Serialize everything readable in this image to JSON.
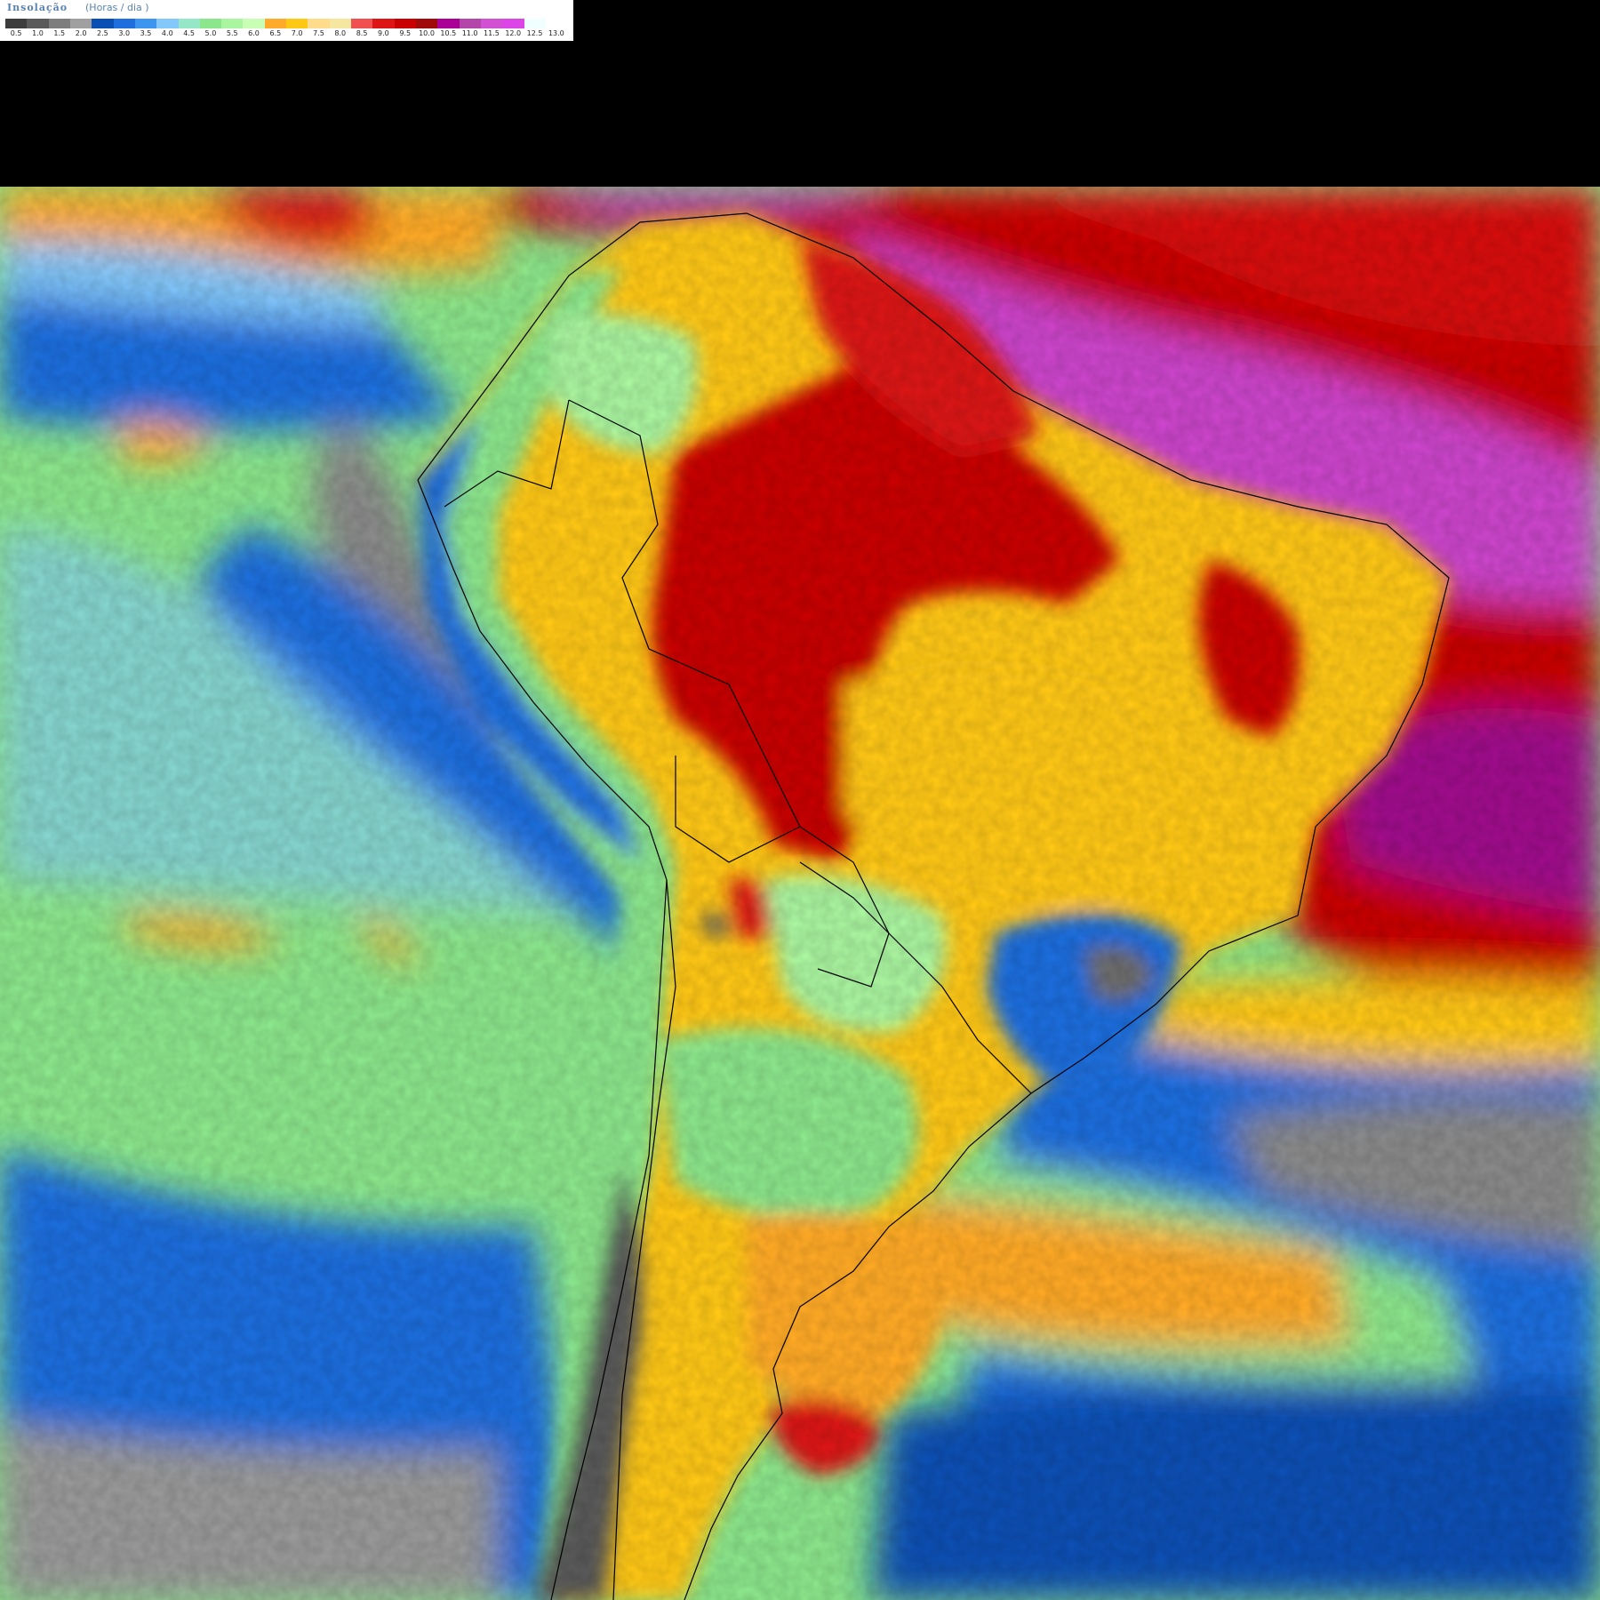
{
  "legend": {
    "title": "Insolação",
    "units": "(Horas / dia )",
    "colors": [
      "#3c3c3c",
      "#5a5a5a",
      "#7d7d7d",
      "#a0a0a0",
      "#0a4fb4",
      "#1e6ede",
      "#3c96f0",
      "#82c8fa",
      "#96e6c8",
      "#8ce68c",
      "#aaf5a0",
      "#c8ffb4",
      "#ffaa28",
      "#ffc814",
      "#ffdc8c",
      "#f5e6a0",
      "#f05050",
      "#dc1414",
      "#c80000",
      "#a00a0a",
      "#aa0096",
      "#b446aa",
      "#d250d2",
      "#dc46e6",
      "#f0ffff",
      "#ffffff"
    ],
    "ticks": [
      "0.5",
      "1.0",
      "1.5",
      "2.0",
      "2.5",
      "3.0",
      "3.5",
      "4.0",
      "4.5",
      "5.0",
      "5.5",
      "6.0",
      "6.5",
      "7.0",
      "7.5",
      "8.0",
      "8.5",
      "9.0",
      "9.5",
      "10.0",
      "10.5",
      "11.0",
      "11.5",
      "12.0",
      "12.5",
      "13.0"
    ]
  },
  "map": {
    "region": "South America",
    "variable": "solar insolation (hours/day)",
    "zones": [
      {
        "name": "ocean-far-north",
        "color": "#ffaa28"
      },
      {
        "name": "atlantic-north-high",
        "color": "#c80000"
      },
      {
        "name": "atlantic-equatorial-max",
        "color": "#cc44cc"
      },
      {
        "name": "pacific-north-band",
        "color": "#1e6ede"
      },
      {
        "name": "pacific-central-green",
        "color": "#aaf5a0"
      },
      {
        "name": "pacific-grey-stratus",
        "color": "#8a8a8a"
      },
      {
        "name": "pacific-south-blue",
        "color": "#1e6ede"
      },
      {
        "name": "southern-ocean-grey",
        "color": "#9a9a9a"
      },
      {
        "name": "amazon-red-core",
        "color": "#c80000"
      },
      {
        "name": "brazil-central-orange",
        "color": "#ffc814"
      },
      {
        "name": "northeast-brazil-red",
        "color": "#c80000"
      },
      {
        "name": "southern-brazil-blue",
        "color": "#1e6ede"
      },
      {
        "name": "patagonia-orange",
        "color": "#ffaa28"
      },
      {
        "name": "andes-mixed",
        "color": "#8ce68c"
      },
      {
        "name": "atlantic-south-orange",
        "color": "#ffc814"
      }
    ]
  }
}
